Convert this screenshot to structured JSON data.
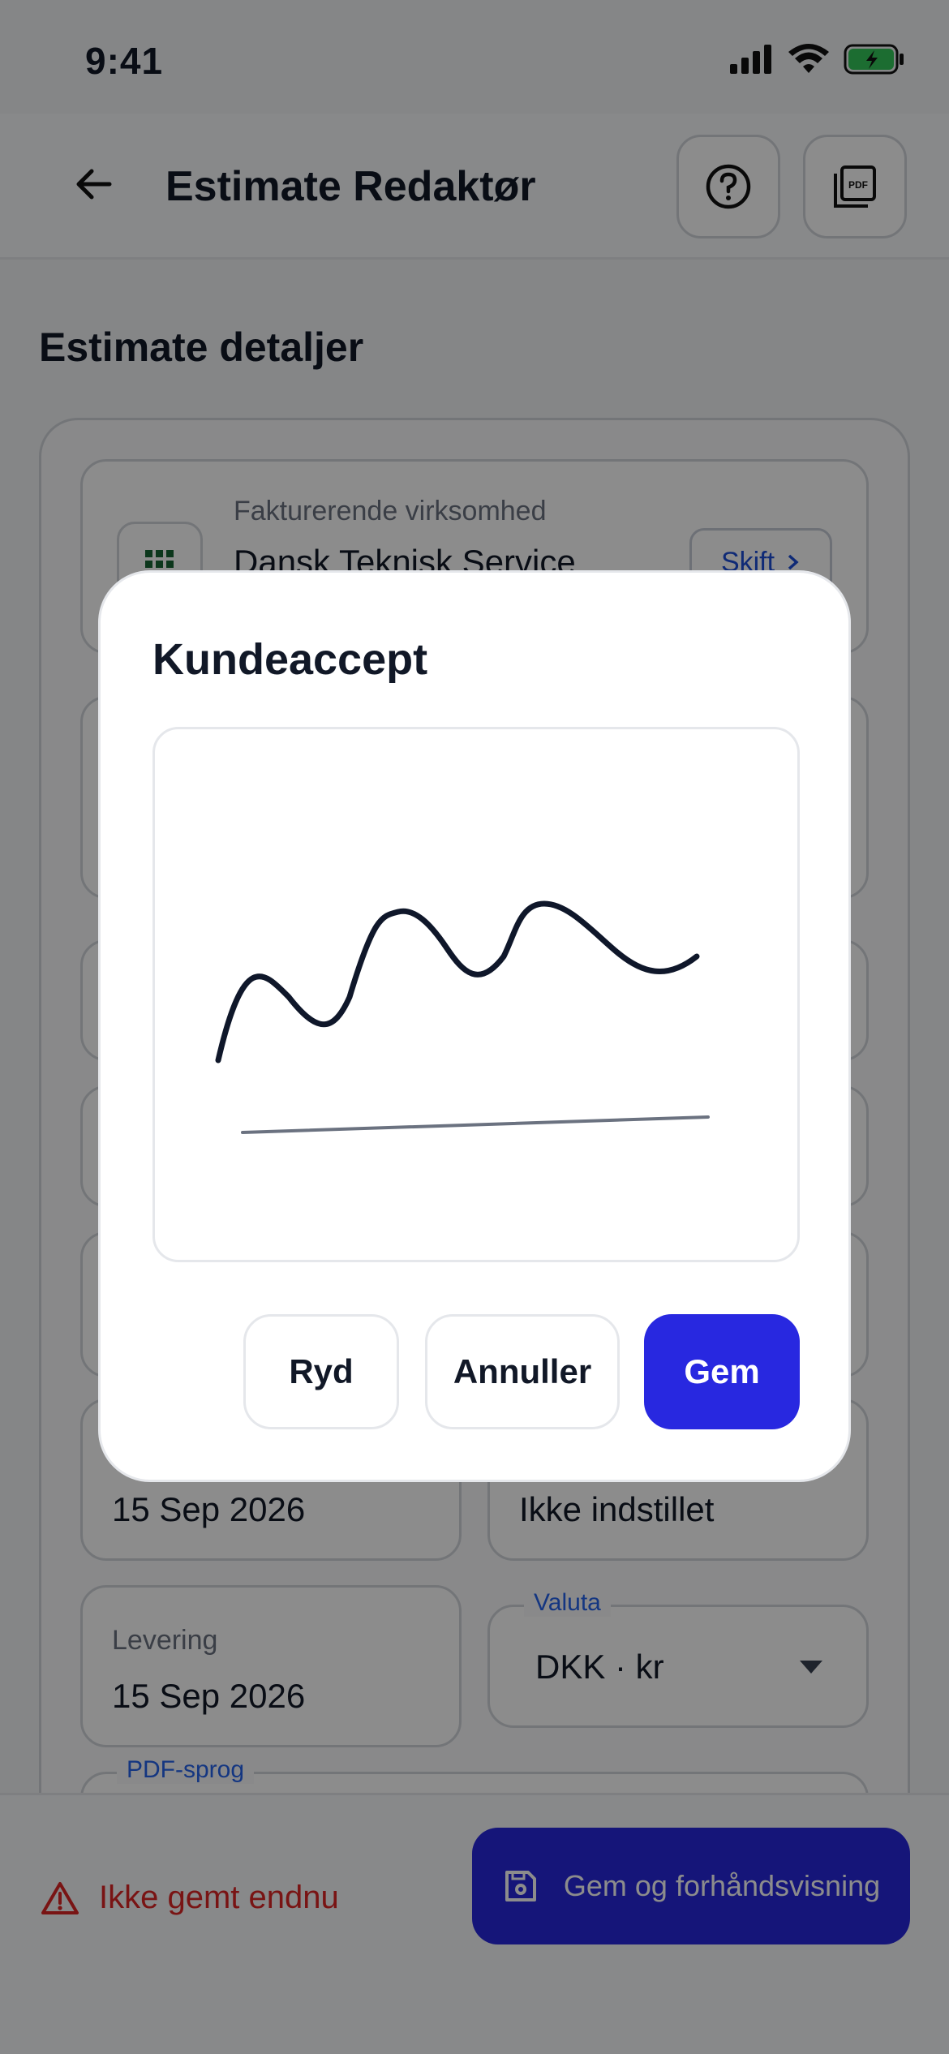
{
  "status_bar": {
    "time": "9:41"
  },
  "app_bar": {
    "title": "Estimate Redaktør",
    "help_icon": "help-circle-icon",
    "pdf_icon": "pdf-icon"
  },
  "section": {
    "title": "Estimate detaljer"
  },
  "business": {
    "label": "Fakturerende virksomhed",
    "name": "Dansk Teknisk Service",
    "change_label": "Skift"
  },
  "dates": {
    "date_value": "15 Sep 2026",
    "due_value": "Ikke indstillet",
    "delivery_label": "Levering",
    "delivery_value": "15 Sep 2026"
  },
  "currency": {
    "label": "Valuta",
    "value": "DKK · kr"
  },
  "pdf_language": {
    "label": "PDF-sprog"
  },
  "footer": {
    "unsaved_text": "Ikke gemt endnu",
    "save_preview_label": "Gem og forhåndsvisning"
  },
  "dialog": {
    "title": "Kundeaccept",
    "clear_label": "Ryd",
    "cancel_label": "Annuller",
    "save_label": "Gem"
  },
  "colors": {
    "primary": "#2828e0",
    "danger": "#dc2626",
    "accent_label": "#2563eb"
  }
}
